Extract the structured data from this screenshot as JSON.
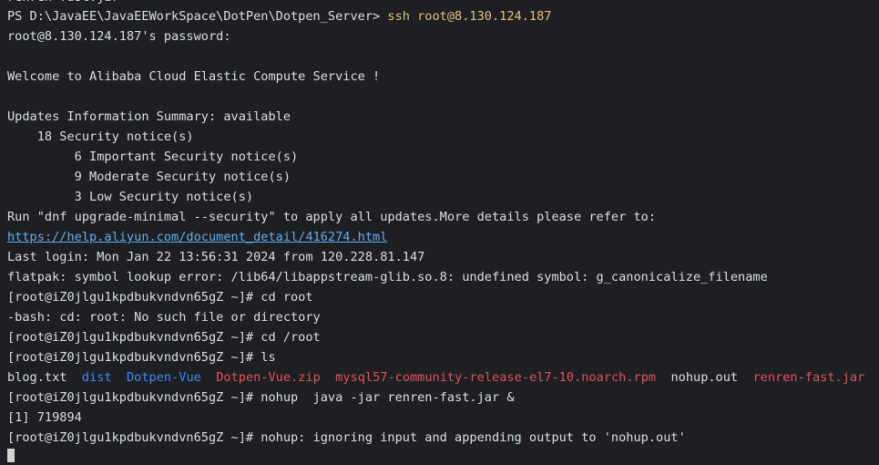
{
  "terminal": {
    "top_partial": "renren-fast.jar",
    "l1_prompt": "PS D:\\JavaEE\\JavaEEWorkSpace\\DotPen\\Dotpen_Server> ",
    "l1_cmd": "ssh root@8.130.124.187",
    "l2": "root@8.130.124.187's password:",
    "l3": "",
    "l4": "Welcome to Alibaba Cloud Elastic Compute Service !",
    "l5": "",
    "l6": "Updates Information Summary: available",
    "l7": "    18 Security notice(s)",
    "l8": "         6 Important Security notice(s)",
    "l9": "         9 Moderate Security notice(s)",
    "l10": "         3 Low Security notice(s)",
    "l11": "Run \"dnf upgrade-minimal --security\" to apply all updates.More details please refer to:",
    "l12_link": "https://help.aliyun.com/document_detail/416274.html",
    "l13": "Last login: Mon Jan 22 13:56:31 2024 from 120.228.81.147",
    "l14": "flatpak: symbol lookup error: /lib64/libappstream-glib.so.8: undefined symbol: g_canonicalize_filename",
    "l15": "[root@iZ0jlgu1kpdbukvndvn65gZ ~]# cd root",
    "l16": "-bash: cd: root: No such file or directory",
    "l17": "[root@iZ0jlgu1kpdbukvndvn65gZ ~]# cd /root",
    "l18": "[root@iZ0jlgu1kpdbukvndvn65gZ ~]# ls",
    "ls": {
      "f1": "blog.txt",
      "d1": "dist",
      "d2": "Dotpen-Vue",
      "a1": "Dotpen-Vue.zip",
      "a2": "mysql57-community-release-el7-10.noarch.rpm",
      "f2": "nohup.out",
      "a3": "renren-fast.jar"
    },
    "l20": "[root@iZ0jlgu1kpdbukvndvn65gZ ~]# nohup  java -jar renren-fast.jar &",
    "l21": "[1] 719894",
    "l22": "[root@iZ0jlgu1kpdbukvndvn65gZ ~]# nohup: ignoring input and appending output to 'nohup.out'"
  },
  "colors": {
    "background": "#1e1f22",
    "text": "#dcdfe4",
    "command": "#e5c07b",
    "link": "#61afef",
    "directory": "#3d8bf5",
    "archive": "#e0525e"
  }
}
